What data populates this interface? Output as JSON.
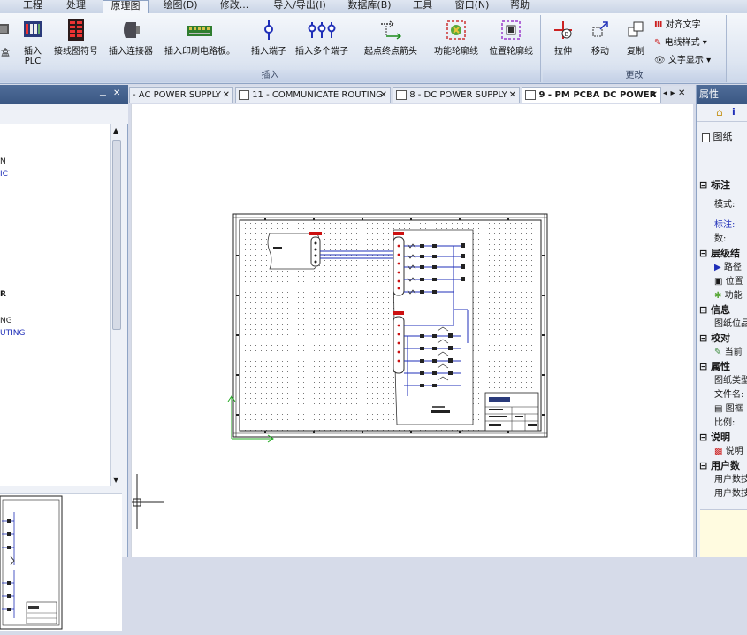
{
  "menu": {
    "tabs": [
      {
        "label": "工程",
        "active": false
      },
      {
        "label": "处理",
        "active": false
      },
      {
        "label": "原理图",
        "active": true
      },
      {
        "label": "绘图(D)",
        "active": false
      },
      {
        "label": "修改...",
        "active": false
      },
      {
        "label": "导入/导出(I)",
        "active": false
      },
      {
        "label": "数据库(B)",
        "active": false
      },
      {
        "label": "工具",
        "active": false
      },
      {
        "label": "窗口(N)",
        "active": false
      },
      {
        "label": "帮助",
        "active": false
      }
    ]
  },
  "ribbon": {
    "insert_group_label": "插入",
    "modify_group_label": "更改",
    "buttons": {
      "box": "盒",
      "insert_plc_line1": "插入",
      "insert_plc_line2": "PLC",
      "wiring_symbol": "接线图符号",
      "insert_connector": "插入连接器",
      "insert_pcb": "插入印刷电路板。",
      "insert_terminal": "插入端子",
      "insert_multi_terminal": "插入多个端子",
      "start_end_arrow": "起点终点箭头",
      "function_outline": "功能轮廓线",
      "location_outline": "位置轮廓线",
      "stretch": "拉伸",
      "move": "移动",
      "copy": "复制",
      "align_text": "对齐文字",
      "wire_style": "电线样式",
      "text_display": "文字显示"
    }
  },
  "left_panel": {
    "pin_icon": "pin-icon",
    "close_label": "✕",
    "tree_lines": [
      "N",
      "IC",
      "R",
      "NG",
      "UTING"
    ]
  },
  "doc_tabs": [
    {
      "label": "- AC POWER SUPPLY",
      "active": false
    },
    {
      "label": "11 - COMMUNICATE ROUTING",
      "active": false
    },
    {
      "label": "8 - DC POWER SUPPLY",
      "active": false
    },
    {
      "label": "9 - PM PCBA DC POWER",
      "active": true
    }
  ],
  "doc_tab_close": "✕",
  "doc_tab_nav": "◂ ▸ ✕",
  "right_panel": {
    "title": "属性",
    "drawing_label": "图纸",
    "sections": [
      {
        "label": "标注",
        "items": [
          "模式:",
          "标注:",
          "数:"
        ]
      },
      {
        "label": "层级结",
        "items": [
          "路径",
          "位置",
          "功能"
        ]
      },
      {
        "label": "信息",
        "items": [
          "图纸位品"
        ]
      },
      {
        "label": "校对",
        "items": [
          "当前"
        ]
      },
      {
        "label": "属性",
        "items": [
          "图纸类型",
          "文件名:",
          "图框",
          "比例:"
        ]
      },
      {
        "label": "说明",
        "items": [
          "说明"
        ]
      },
      {
        "label": "用户数",
        "items": [
          "用户数技",
          "用户数技"
        ]
      }
    ]
  },
  "colors": {
    "accent_blue": "#3a5783",
    "wire_blue": "#1f2fb8",
    "component_red": "#cc1111",
    "crosshair_green": "#22aa22"
  }
}
